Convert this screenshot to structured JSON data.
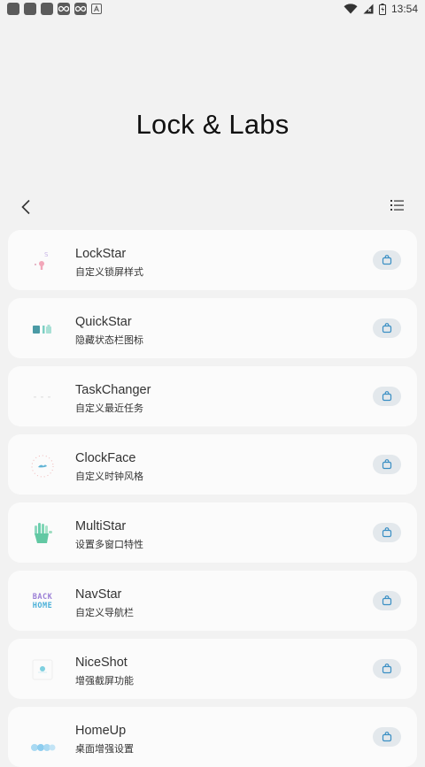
{
  "status_bar": {
    "time": "13:54"
  },
  "header": {
    "title": "Lock & Labs"
  },
  "apps": [
    {
      "name": "LockStar",
      "desc": "自定义锁屏样式",
      "icon": "lockstar-icon"
    },
    {
      "name": "QuickStar",
      "desc": "隐藏状态栏图标",
      "icon": "quickstar-icon"
    },
    {
      "name": "TaskChanger",
      "desc": "自定义最近任务",
      "icon": "taskchanger-icon"
    },
    {
      "name": "ClockFace",
      "desc": "自定义时钟风格",
      "icon": "clockface-icon"
    },
    {
      "name": "MultiStar",
      "desc": "设置多窗口特性",
      "icon": "multistar-icon"
    },
    {
      "name": "NavStar",
      "desc": "自定义导航栏",
      "icon": "navstar-icon",
      "icon_text": [
        "BACK",
        "HOME"
      ]
    },
    {
      "name": "NiceShot",
      "desc": "增强截屏功能",
      "icon": "niceshot-icon"
    },
    {
      "name": "HomeUp",
      "desc": "桌面增强设置",
      "icon": "homeup-icon"
    }
  ],
  "colors": {
    "accent": "#3a8fc4",
    "action_bg": "#e3e8ec"
  }
}
